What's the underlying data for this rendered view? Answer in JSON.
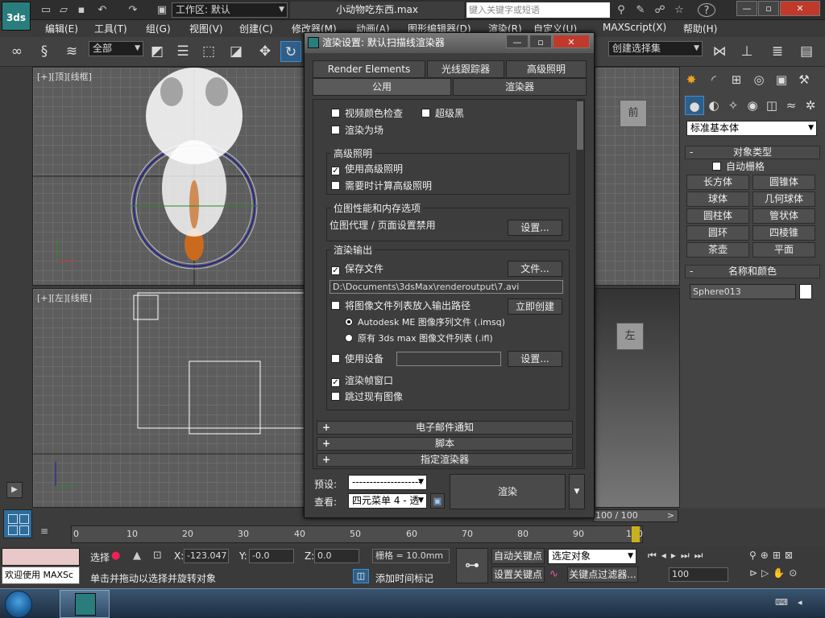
{
  "app": {
    "title": "小动物吃东西.max",
    "workspace_label": "工作区: 默认",
    "search_placeholder": "键入关键字或短语",
    "logo": "3ds"
  },
  "menubar": [
    "编辑(E)",
    "工具(T)",
    "组(G)",
    "视图(V)",
    "创建(C)",
    "修改器(M)",
    "动画(A)",
    "图形编辑器(D)",
    "渲染(R)",
    "自定义(U)",
    "MAXScript(X)",
    "帮助(H)"
  ],
  "toolbar": {
    "selection_filter": "全部",
    "named_selection": "创建选择集"
  },
  "viewports": {
    "top": {
      "label": "[+][顶][线框]"
    },
    "left": {
      "label": "[+][左][线框]"
    },
    "front_cube": "前",
    "left_cube": "左"
  },
  "command_panel": {
    "category": "标准基本体",
    "object_type_title": "对象类型",
    "auto_grid": "自动栅格",
    "objects": [
      "长方体",
      "圆锥体",
      "球体",
      "几何球体",
      "圆柱体",
      "管状体",
      "圆环",
      "四棱锥",
      "茶壶",
      "平面"
    ],
    "name_color_title": "名称和颜色",
    "object_name": "Sphere013"
  },
  "dialog": {
    "title": "渲染设置: 默认扫描线渲染器",
    "tabs_row1": [
      "Render Elements",
      "光线跟踪器",
      "高级照明"
    ],
    "tabs_row2": [
      "公用",
      "渲染器"
    ],
    "video_color_check": "视频颜色检查",
    "super_black": "超级黑",
    "render_to_fields": "渲染为场",
    "adv_lighting_title": "高级照明",
    "use_adv_lighting": "使用高级照明",
    "compute_adv_lighting": "需要时计算高级照明",
    "bitmap_title": "位图性能和内存选项",
    "bitmap_proxy": "位图代理 / 页面设置禁用",
    "setup_button": "设置...",
    "render_output_title": "渲染输出",
    "save_file": "保存文件",
    "files_button": "文件...",
    "output_path": "D:\\Documents\\3dsMax\\renderoutput\\7.avi",
    "put_image_list": "将图像文件列表放入输出路径",
    "create_now": "立即创建",
    "imsq_option": "Autodesk ME 图像序列文件 (.imsq)",
    "ifl_option": "原有 3ds max 图像文件列表 (.ifl)",
    "use_device": "使用设备",
    "device_setup": "设置...",
    "rendered_frame_window": "渲染帧窗口",
    "skip_existing": "跳过现有图像",
    "rollouts": [
      "电子邮件通知",
      "脚本",
      "指定渲染器"
    ],
    "preset_label": "预设:",
    "preset_value": "--------------------",
    "view_label": "查看:",
    "view_value": "四元菜单 4 - 透",
    "render_button": "渲染",
    "checkbox_states": {
      "video_color_check": false,
      "super_black": false,
      "render_to_fields": false,
      "use_adv_lighting": true,
      "compute_adv_lighting": false,
      "save_file": true,
      "put_image_list": false,
      "use_device": false,
      "rendered_frame_window": true,
      "skip_existing": false
    },
    "selected_output_list_format": "imsq"
  },
  "timeline": {
    "frame_display": "100 / 100",
    "ticks": [
      "0",
      "10",
      "20",
      "30",
      "40",
      "50",
      "60",
      "70",
      "80",
      "90",
      "100"
    ]
  },
  "status": {
    "maxscript_welcome": "欢迎使用 MAXSc",
    "select_label": "选择",
    "x_label": "X:",
    "x_value": "-123.047",
    "y_label": "Y:",
    "y_value": "-0.0",
    "z_label": "Z:",
    "z_value": "0.0",
    "grid_label": "栅格 = 10.0mm",
    "auto_key": "自动关键点",
    "selected_object": "选定对象",
    "set_key": "设置关键点",
    "key_filters": "关键点过滤器...",
    "frame_spinner": "100",
    "prompt": "单击并拖动以选择并旋转对象",
    "add_time_tag": "添加时间标记"
  },
  "colors": {
    "accent": "#2a7d7d",
    "dialog_bg": "#3d3d3d",
    "viewport_bg": "#5d5d5d"
  }
}
